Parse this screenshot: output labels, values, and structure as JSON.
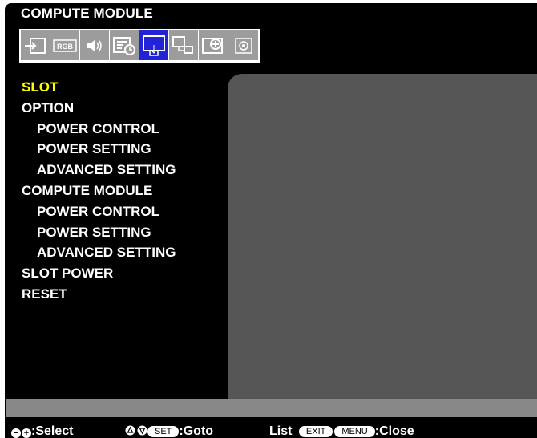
{
  "osd": {
    "title": "COMPUTE MODULE"
  },
  "tabs": [
    {
      "icon": "input-icon",
      "active": false
    },
    {
      "icon": "rgb-icon",
      "label": "RGB",
      "active": false
    },
    {
      "icon": "audio-icon",
      "active": false
    },
    {
      "icon": "schedule-icon",
      "active": false
    },
    {
      "icon": "computer-module-icon",
      "active": true
    },
    {
      "icon": "network-icon",
      "active": false
    },
    {
      "icon": "protect-icon",
      "active": false
    },
    {
      "icon": "system-icon",
      "active": false
    }
  ],
  "menu": {
    "items": [
      {
        "label": "SLOT",
        "level": 0,
        "selected": true
      },
      {
        "label": "OPTION",
        "level": 0
      },
      {
        "label": "POWER CONTROL",
        "level": 1
      },
      {
        "label": "POWER SETTING",
        "level": 1
      },
      {
        "label": "ADVANCED SETTING",
        "level": 1
      },
      {
        "label": "COMPUTE MODULE",
        "level": 0
      },
      {
        "label": "POWER CONTROL",
        "level": 1
      },
      {
        "label": "POWER SETTING",
        "level": 1
      },
      {
        "label": "ADVANCED SETTING",
        "level": 1
      },
      {
        "label": "SLOT POWER",
        "level": 0
      },
      {
        "label": "RESET",
        "level": 0
      }
    ]
  },
  "footer": {
    "select_text": ":Select",
    "set_key": "SET",
    "goto_text": ":Goto",
    "list_text": "List",
    "exit_key": "EXIT",
    "menu_key": "MENU",
    "close_text": ":Close"
  },
  "colors": {
    "background": "#000000",
    "panel": "#555555",
    "tab_inactive": "#9c9c9c",
    "tab_active": "#2222d8",
    "selected_text": "#ffff00"
  }
}
